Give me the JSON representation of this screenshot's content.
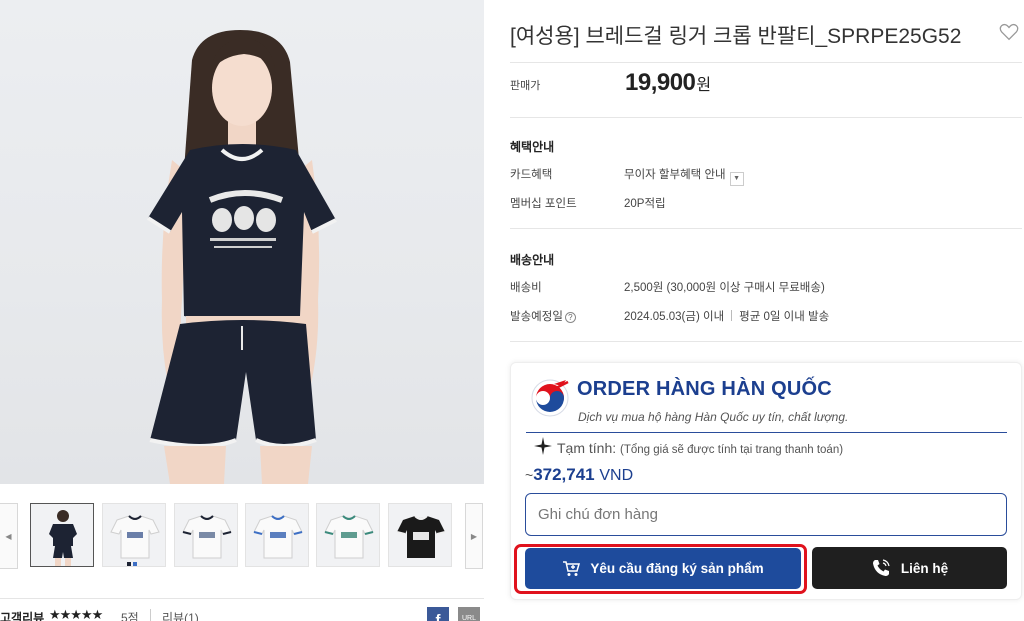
{
  "product": {
    "title": "[여성용] 브레드걸 링거 크롭 반팔티_SPRPE25G52",
    "price_label": "판매가",
    "price": "19,900",
    "price_unit": "원"
  },
  "benefits": {
    "heading": "혜택안내",
    "card_label": "카드혜택",
    "card_value": "무이자 할부혜택 안내",
    "points_label": "멤버십 포인트",
    "points_value": "20P적립"
  },
  "shipping": {
    "heading": "배송안내",
    "fee_label": "배송비",
    "fee_value": "2,500원 (30,000원 이상 구매시 무료배송)",
    "date_label": "발송예정일",
    "date_value": "2024.05.03(금) 이내",
    "date_avg": "평균 0일 이내 발송"
  },
  "reviews": {
    "label": "고객리뷰",
    "stars": "★★★★★",
    "score": "5점",
    "count": "리뷰(1)"
  },
  "share": {
    "facebook": "f",
    "url": "URL"
  },
  "order_widget": {
    "brand": "ORDER HÀNG HÀN QUỐC",
    "tagline": "Dịch vụ mua hộ hàng Hàn Quốc uy tín, chất lượng.",
    "estimate_label": "Tạm tính:",
    "estimate_note": "(Tổng giá sẽ được tính tại trang thanh toán)",
    "estimate_prefix": "~",
    "estimate_amount": "372,741",
    "estimate_currency": "VND",
    "note_placeholder": "Ghi chú đơn hàng",
    "register_button": "Yêu cầu đăng ký sản phẩm",
    "contact_button": "Liên hệ"
  },
  "colors": {
    "brand_blue": "#1e4b9c",
    "highlight_red": "#e0121d",
    "dark_button": "#1f1f1f"
  }
}
